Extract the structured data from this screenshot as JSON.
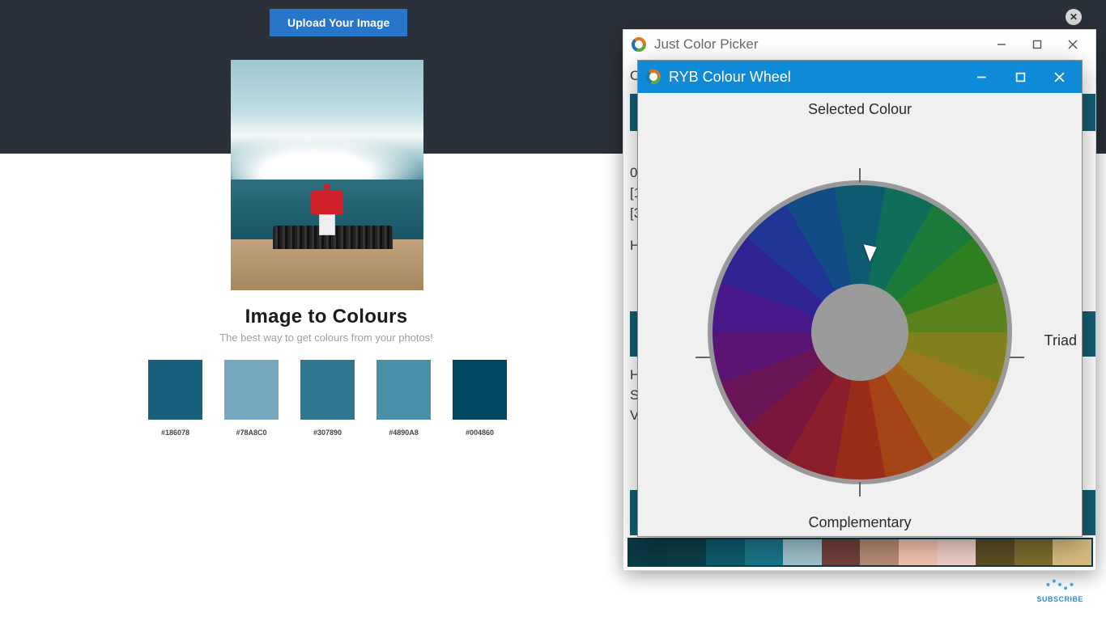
{
  "page": {
    "upload_label": "Upload Your Image",
    "title": "Image to Colours",
    "subtitle": "The best way to get colours from your photos!",
    "swatches": [
      {
        "hex": "#18607B",
        "label": "#186078"
      },
      {
        "hex": "#78A8C0",
        "label": "#78A8C0"
      },
      {
        "hex": "#307890",
        "label": "#307890"
      },
      {
        "hex": "#4890A8",
        "label": "#4890A8"
      },
      {
        "hex": "#004860",
        "label": "#004860"
      }
    ]
  },
  "jcp": {
    "title": "Just Color Picker",
    "left_rows": [
      "O",
      "0:",
      "[1",
      "[3",
      "H",
      "H",
      "S:",
      "V"
    ],
    "palette": [
      "#0b3b46",
      "#0c3e49",
      "#0f5a6e",
      "#197488",
      "#9fbfca",
      "#723f3a",
      "#b58a73",
      "#f2c2ae",
      "#eecfc6",
      "#5b4c24",
      "#7c6a2f",
      "#d6bb7e"
    ]
  },
  "ryb": {
    "title": "RYB Colour Wheel",
    "labels": {
      "selected": "Selected Colour",
      "complementary": "Complementary",
      "triad": "Triad"
    },
    "segments": [
      "#0e5a70",
      "#0f6e5b",
      "#1a7a3a",
      "#2f7f20",
      "#5a831e",
      "#83811d",
      "#9a7a1c",
      "#a4611a",
      "#a34316",
      "#9a2d1a",
      "#8c1d2a",
      "#7a163e",
      "#6a1458",
      "#5a1572",
      "#47198a",
      "#2f2394",
      "#1f3696",
      "#134b87"
    ]
  },
  "subscribe": {
    "label": "SUBSCRIBE"
  }
}
